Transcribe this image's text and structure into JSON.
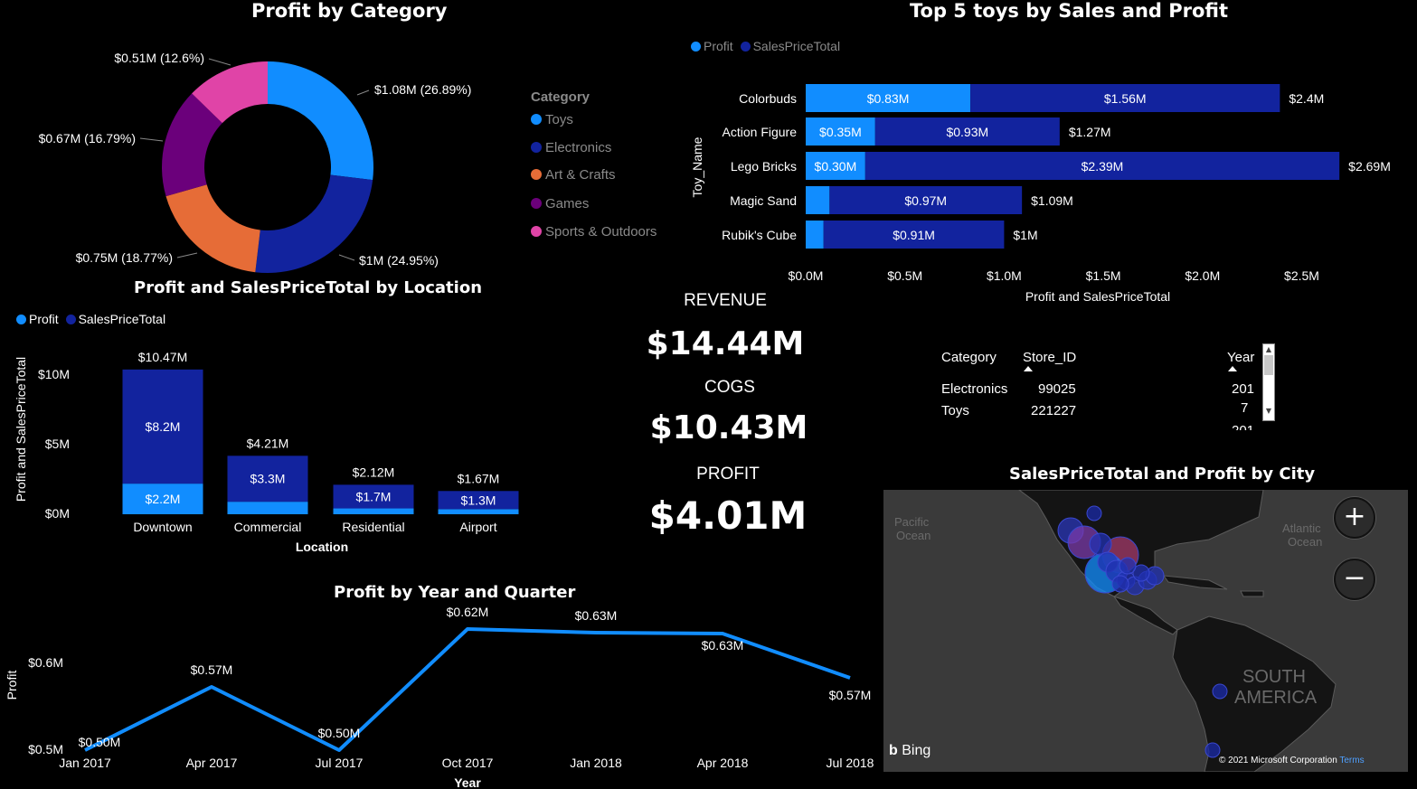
{
  "colors": {
    "profit": "#118dff",
    "sales": "#12239e",
    "art": "#e66c37",
    "games": "#6b007b",
    "sports": "#e044a7",
    "axis_gray": "#8a8a8a"
  },
  "donut": {
    "title": "Profit by Category",
    "legend_title": "Category",
    "chart_data": {
      "type": "pie",
      "title": "Profit by Category",
      "slices": [
        {
          "name": "Toys",
          "value": 1.08,
          "label": "$1.08M (26.89%)",
          "color": "#118dff"
        },
        {
          "name": "Electronics",
          "value": 1.0,
          "label": "$1M (24.95%)",
          "color": "#12239e"
        },
        {
          "name": "Art & Crafts",
          "value": 0.75,
          "label": "$0.75M (18.77%)",
          "color": "#e66c37"
        },
        {
          "name": "Games",
          "value": 0.67,
          "label": "$0.67M (16.79%)",
          "color": "#6b007b"
        },
        {
          "name": "Sports & Outdoors",
          "value": 0.51,
          "label": "$0.51M (12.6%)",
          "color": "#e044a7"
        }
      ]
    }
  },
  "top5": {
    "title": "Top 5 toys by Sales and Profit",
    "legend": [
      "Profit",
      "SalesPriceTotal"
    ],
    "ylabel": "Toy_Name",
    "xlabel": "Profit and SalesPriceTotal",
    "chart_data": {
      "type": "bar",
      "orientation": "horizontal",
      "stacked": true,
      "categories": [
        "Colorbuds",
        "Action Figure",
        "Lego Bricks",
        "Magic Sand",
        "Rubik's Cube"
      ],
      "series": [
        {
          "name": "Profit",
          "values": [
            0.83,
            0.35,
            0.3,
            0.12,
            0.09
          ],
          "labels": [
            "$0.83M",
            "$0.35M",
            "$0.30M",
            "",
            ""
          ]
        },
        {
          "name": "SalesPriceTotal",
          "values": [
            1.56,
            0.93,
            2.39,
            0.97,
            0.91
          ],
          "labels": [
            "$1.56M",
            "$0.93M",
            "$2.39M",
            "$0.97M",
            "$0.91M"
          ]
        }
      ],
      "totals": [
        "$2.4M",
        "$1.27M",
        "$2.69M",
        "$1.09M",
        "$1M"
      ],
      "xticks": [
        "$0.0M",
        "$0.5M",
        "$1.0M",
        "$1.5M",
        "$2.0M",
        "$2.5M"
      ],
      "xlim": [
        0,
        2.5
      ]
    }
  },
  "location": {
    "title": "Profit and SalesPriceTotal by Location",
    "legend": [
      "Profit",
      "SalesPriceTotal"
    ],
    "ylabel": "Profit and SalesPriceTotal",
    "xlabel": "Location",
    "chart_data": {
      "type": "bar",
      "stacked": true,
      "categories": [
        "Downtown",
        "Commercial",
        "Residential",
        "Airport"
      ],
      "series": [
        {
          "name": "Profit",
          "values": [
            2.2,
            0.9,
            0.42,
            0.37
          ],
          "labels": [
            "$2.2M",
            "",
            "",
            ""
          ]
        },
        {
          "name": "SalesPriceTotal",
          "values": [
            8.2,
            3.3,
            1.7,
            1.3
          ],
          "labels": [
            "$8.2M",
            "$3.3M",
            "$1.7M",
            "$1.3M"
          ]
        }
      ],
      "totals": [
        "$10.47M",
        "$4.21M",
        "$2.12M",
        "$1.67M"
      ],
      "yticks": [
        "$0M",
        "$5M",
        "$10M"
      ],
      "ylim": [
        0,
        10
      ]
    }
  },
  "kpis": [
    {
      "label": "REVENUE",
      "value": "$14.44M"
    },
    {
      "label": "COGS",
      "value": "$10.43M"
    },
    {
      "label": "PROFIT",
      "value": "$4.01M"
    }
  ],
  "table": {
    "headers": [
      "Category",
      "Store_ID",
      "Year"
    ],
    "rows": [
      [
        "Electronics",
        "99025",
        "201"
      ],
      [
        "Toys",
        "221227",
        "7"
      ]
    ],
    "partial_row": "201",
    "scroll_up": "▲",
    "scroll_down": "▼"
  },
  "line": {
    "title": "Profit by Year and Quarter",
    "ylabel": "Profit",
    "xlabel": "Year",
    "chart_data": {
      "type": "line",
      "x": [
        "Jan 2017",
        "Apr 2017",
        "Jul 2017",
        "Oct 2017",
        "Jan 2018",
        "Apr 2018",
        "Jul 2018"
      ],
      "series": [
        {
          "name": "Profit",
          "values": [
            0.5,
            0.57,
            0.5,
            0.62,
            0.63,
            0.63,
            0.57
          ],
          "labels": [
            "$0.50M",
            "$0.57M",
            "$0.50M",
            "$0.62M",
            "$0.63M",
            "$0.63M",
            "$0.57M"
          ]
        }
      ],
      "yticks": [
        "$0.5M",
        "$0.6M"
      ],
      "ylim": [
        0.5,
        0.6
      ]
    }
  },
  "map": {
    "title": "SalesPriceTotal and Profit by City",
    "ocean_pacific": "Pacific\nOcean",
    "ocean_atlantic": "Atlantic\nOcean",
    "continent": "SOUTH\nAMERICA",
    "zoom_in": "+",
    "zoom_out": "−",
    "bing": "Bing",
    "copyright": "© 2021 Microsoft Corporation",
    "terms": "Terms"
  }
}
